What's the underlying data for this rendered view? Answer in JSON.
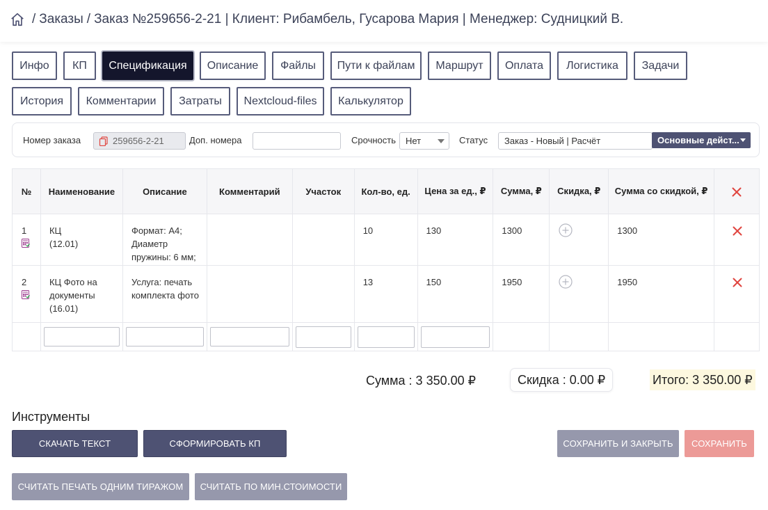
{
  "breadcrumb": {
    "home_icon": "home-icon",
    "sep": "/",
    "orders": "Заказы",
    "current": "Заказ №259656-2-21 | Клиент: Рибамбель, Гусарова Мария | Менеджер: Судницкий В."
  },
  "tabs_row1": [
    "Инфо",
    "КП",
    "Спецификация",
    "Описание",
    "Файлы",
    "Пути к файлам",
    "Маршрут",
    "Оплата",
    "Логистика",
    "Задачи"
  ],
  "tabs_row2": [
    "История",
    "Комментарии",
    "Затраты",
    "Nextcloud-files",
    "Калькулятор"
  ],
  "active_tab": "Спецификация",
  "order_bar": {
    "order_number_label": "Номер заказа",
    "order_number_value": "259656-2-21",
    "extra_numbers_label": "Доп. номера",
    "extra_numbers_value": "",
    "urgency_label": "Срочность",
    "urgency_value": "Нет",
    "status_label": "Статус",
    "status_value": "Заказ - Новый | Расчёт",
    "actions_label": "Основные дейст..."
  },
  "table": {
    "headers": [
      "№",
      "Наименование",
      "Описание",
      "Комментарий",
      "Участок",
      "Кол-во, ед.",
      "Цена за ед., ₽",
      "Сумма, ₽",
      "Скидка, ₽",
      "Сумма со скидкой, ₽"
    ],
    "rows": [
      {
        "num": "1",
        "name": "КЦ",
        "name_code": "(12.01)",
        "desc": "Формат: А4; Диаметр пружины: 6 мм;",
        "comment": "",
        "area": "",
        "qty": "10",
        "price": "130",
        "sum": "1300",
        "sum_discount": "1300"
      },
      {
        "num": "2",
        "name": "КЦ Фото на документы",
        "name_code": "(16.01)",
        "desc": "Услуга: печать комплекта фото",
        "comment": "",
        "area": "",
        "qty": "13",
        "price": "150",
        "sum": "1950",
        "sum_discount": "1950"
      }
    ]
  },
  "totals": {
    "sum": "Сумма : 3 350.00 ₽",
    "discount": "Скидка : 0.00 ₽",
    "total": "Итого: 3 350.00 ₽"
  },
  "tools": {
    "title": "Инструменты",
    "download_text": "СКАЧАТЬ ТЕКСТ",
    "form_kp": "СФОРМИРОВАТЬ КП",
    "save_close": "СОХРАНИТЬ И ЗАКРЫТЬ",
    "save": "СОХРАНИТЬ",
    "calc_single_run": "СЧИТАТЬ ПЕЧАТЬ ОДНИМ ТИРАЖОМ",
    "calc_min_cost": "СЧИТАТЬ ПО МИН.СТОИМОСТИ"
  },
  "colors": {
    "primary": "#4e5273",
    "active_tab": "#14162c",
    "delete": "#e0453f",
    "save": "#ec9a97",
    "total_bg": "#fdf8df"
  }
}
